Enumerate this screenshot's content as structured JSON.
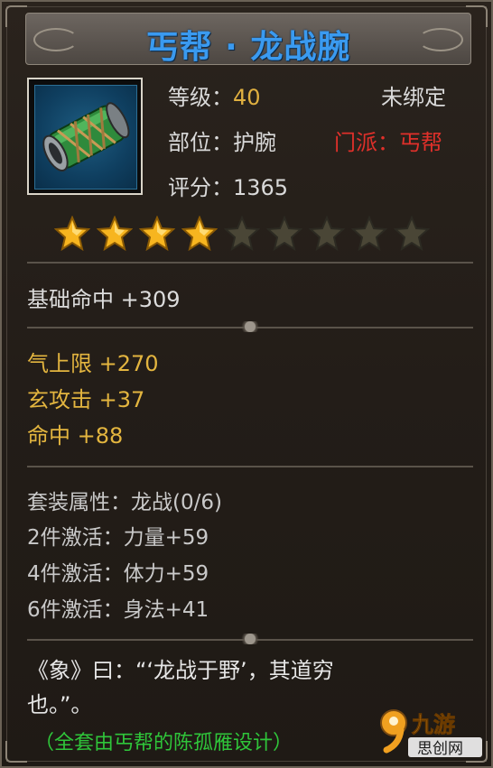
{
  "item": {
    "name": "丐帮 · 龙战腕",
    "icon": "green-wrist-bracer-icon",
    "level_label": "等级：",
    "level_value": "40",
    "bind_status": "未绑定",
    "slot_label": "部位：",
    "slot_value": "护腕",
    "sect_label": "门派：",
    "sect_value": "丐帮",
    "score_label": "评分：",
    "score_value": "1365",
    "stars_filled": 4,
    "stars_total": 9
  },
  "base_stats": [
    {
      "label": "基础命中",
      "value": "+309"
    }
  ],
  "bonus_stats": [
    {
      "label": "气上限",
      "value": "+270"
    },
    {
      "label": "玄攻击",
      "value": "+37"
    },
    {
      "label": "命中",
      "value": "+88"
    }
  ],
  "set": {
    "title_label": "套装属性：",
    "title_value": "龙战(0/6)",
    "bonuses": [
      {
        "label": "2件激活：",
        "value": "力量+59"
      },
      {
        "label": "4件激活：",
        "value": "体力+59"
      },
      {
        "label": "6件激活：",
        "value": "身法+41"
      }
    ]
  },
  "flavor": {
    "line1": "《象》曰：“‘龙战于野’，其道穷",
    "line2": "也。”。",
    "credit": "（全套由丐帮的陈孤雁设计）"
  },
  "watermark": {
    "logo_text": "九游",
    "sub_text": "思创网"
  },
  "colors": {
    "title": "#3a9af0",
    "gold": "#e3b53f",
    "red": "#e0302a",
    "green": "#2fc53a"
  }
}
